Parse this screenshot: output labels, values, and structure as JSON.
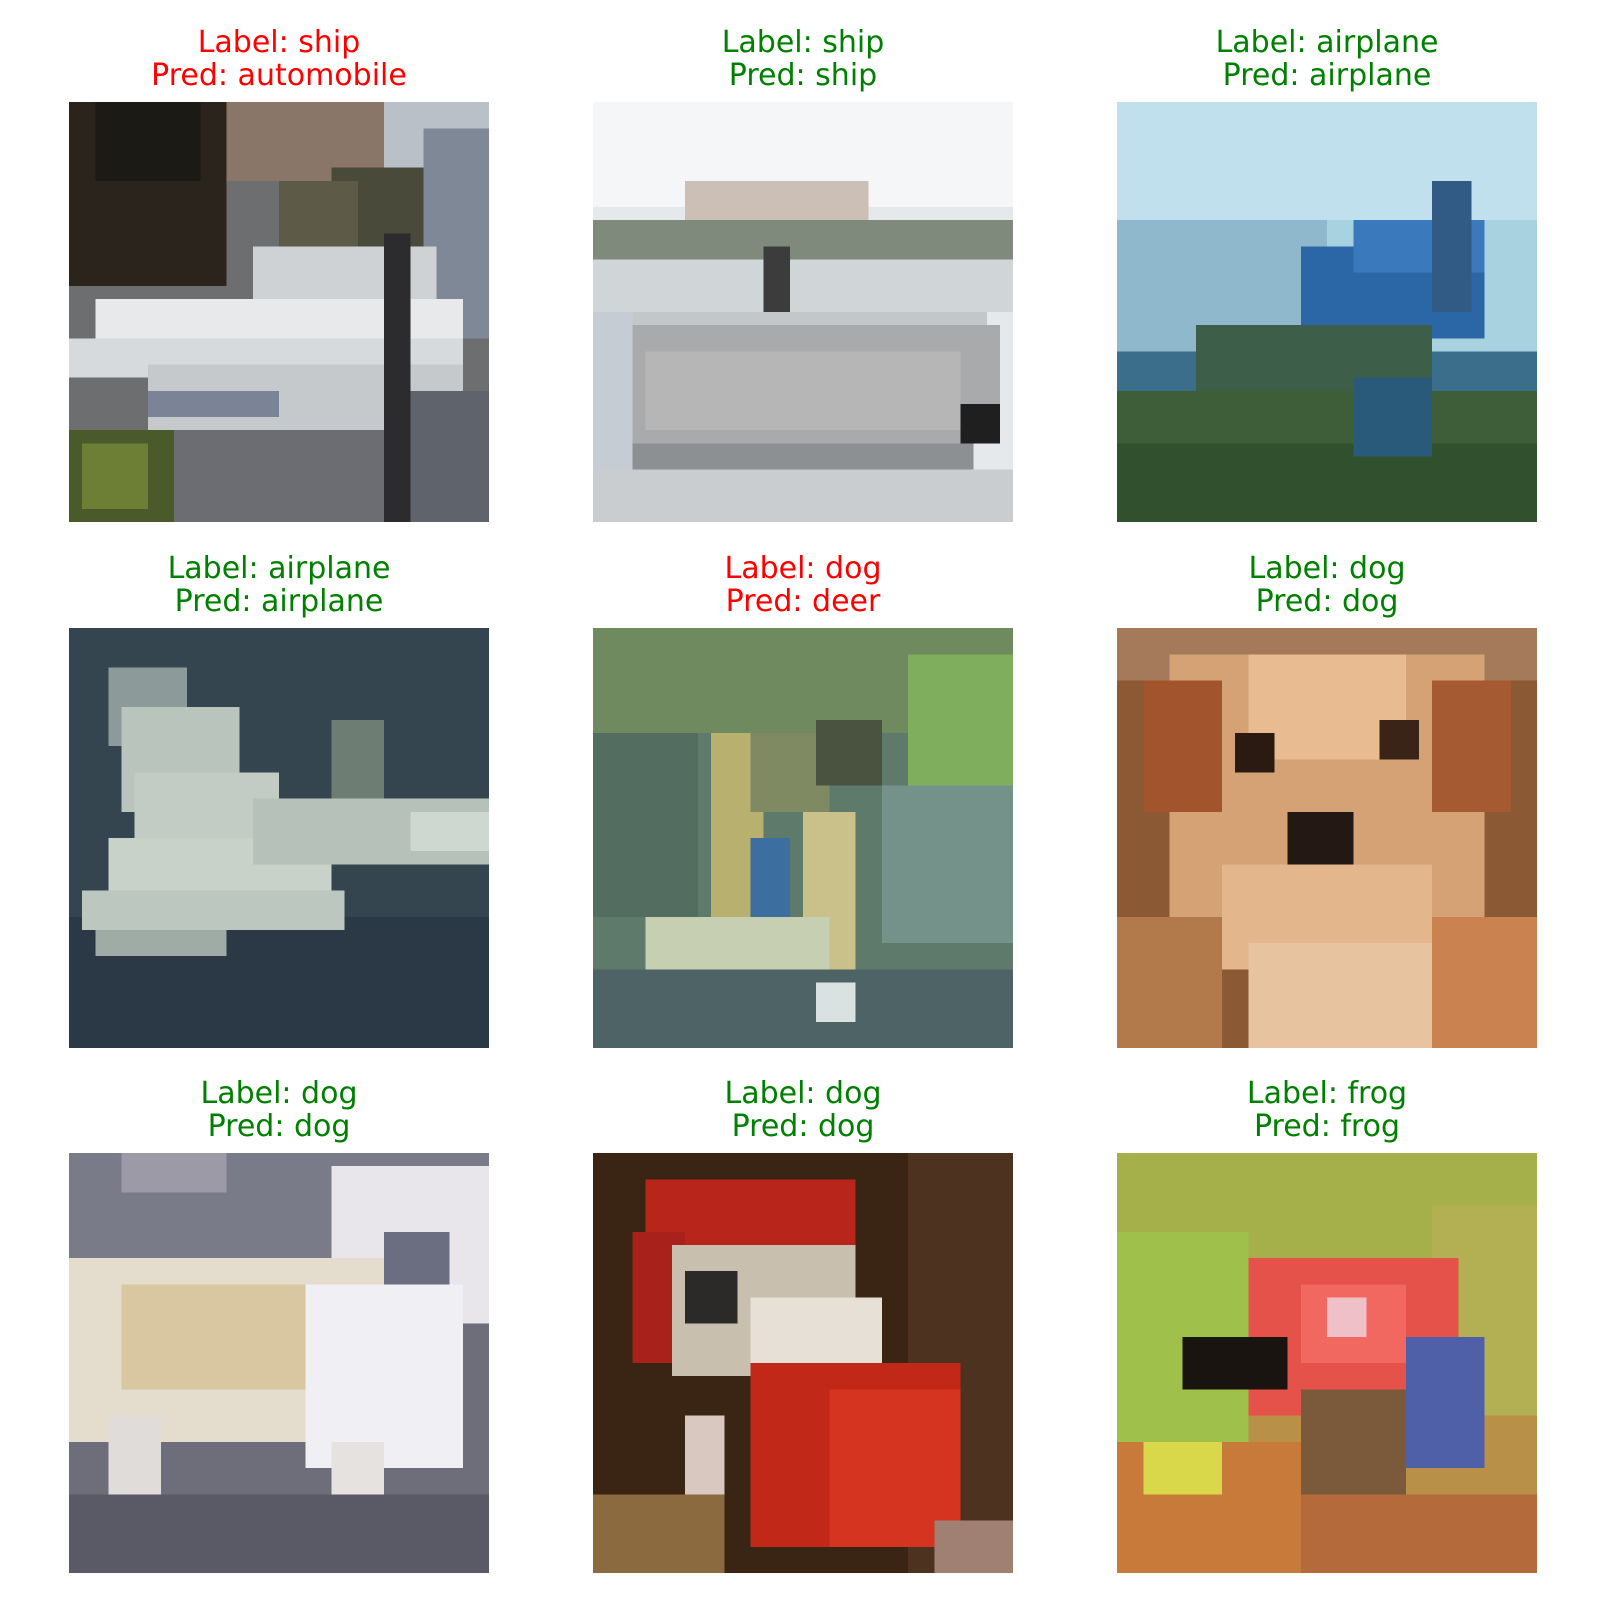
{
  "colors": {
    "correct": "#008000",
    "incorrect": "#ff0000"
  },
  "samples": [
    {
      "label": "Label: ship",
      "pred": "Pred: automobile",
      "correct": false,
      "image_name": "cifar-ship-boat-image"
    },
    {
      "label": "Label: ship",
      "pred": "Pred: ship",
      "correct": true,
      "image_name": "cifar-ship-image"
    },
    {
      "label": "Label: airplane",
      "pred": "Pred: airplane",
      "correct": true,
      "image_name": "cifar-airplane-sky-image"
    },
    {
      "label": "Label: airplane",
      "pred": "Pred: airplane",
      "correct": true,
      "image_name": "cifar-airplane-image"
    },
    {
      "label": "Label: dog",
      "pred": "Pred: deer",
      "correct": false,
      "image_name": "cifar-dog-grass-image"
    },
    {
      "label": "Label: dog",
      "pred": "Pred: dog",
      "correct": true,
      "image_name": "cifar-dog-face-image"
    },
    {
      "label": "Label: dog",
      "pred": "Pred: dog",
      "correct": true,
      "image_name": "cifar-white-dog-image"
    },
    {
      "label": "Label: dog",
      "pred": "Pred: dog",
      "correct": true,
      "image_name": "cifar-dog-red-image"
    },
    {
      "label": "Label: frog",
      "pred": "Pred: frog",
      "correct": true,
      "image_name": "cifar-frog-image"
    }
  ]
}
